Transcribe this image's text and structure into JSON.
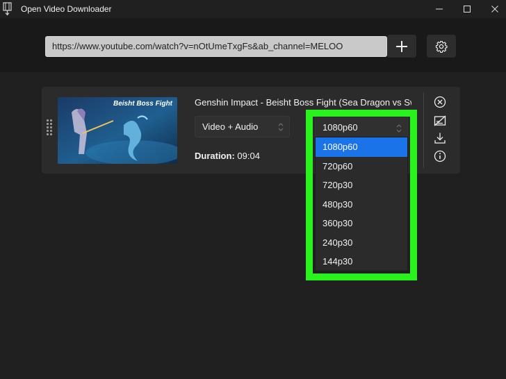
{
  "window": {
    "title": "Open Video Downloader"
  },
  "toolbar": {
    "url_value": "https://www.youtube.com/watch?v=nOtUmeTxgFs&ab_channel=MELOO"
  },
  "video": {
    "title": "Genshin Impact - Beisht Boss Fight (Sea Dragon vs Sword)",
    "thumbnail_caption": "Beisht Boss Fight",
    "type_value": "Video + Audio",
    "duration_label": "Duration:",
    "duration_value": "09:04",
    "quality_value": "1080p60",
    "quality_options": [
      "1080p60",
      "720p60",
      "720p30",
      "480p30",
      "360p30",
      "240p30",
      "144p30"
    ],
    "selected_quality_index": 0
  },
  "colors": {
    "highlight_frame": "#29f21f",
    "selected_option": "#1a73e8"
  },
  "icons": [
    "app-film-icon",
    "minimize-icon",
    "maximize-icon",
    "close-icon",
    "plus-icon",
    "gear-icon",
    "drag-handle-icon",
    "remove-icon",
    "no-subtitles-icon",
    "download-icon",
    "info-icon"
  ]
}
